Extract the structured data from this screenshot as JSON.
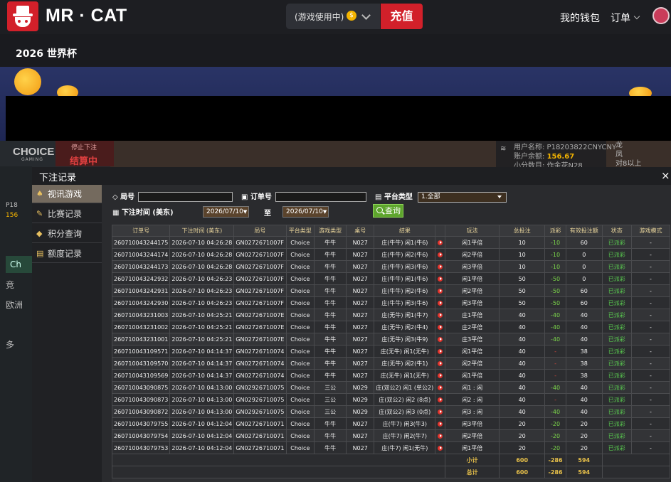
{
  "header": {
    "brand": "MR · CAT",
    "game_status": "(游戏使用中)",
    "recharge_label": "充值",
    "wallet_label": "我的钱包",
    "orders_label": "订单",
    "worldcup_label": "2026 世界杯"
  },
  "background": {
    "choice_logo": "CHOICE",
    "choice_sub": "GAMING",
    "bet_status": "停止下注",
    "bet_result": "结算中",
    "user_line1": "用户名称: P18203822CNYCNY",
    "user_line2_label": "账户余额:",
    "user_balance": "156.67",
    "user_line3": "小分数目: 作金花N28",
    "right_names": [
      "龙",
      "凤",
      "对8以上"
    ],
    "left_items": [
      "竞",
      "欧洲",
      "多"
    ],
    "left_green": "Ch",
    "left_partial": [
      "P18",
      "156"
    ]
  },
  "modal": {
    "title": "下注记录",
    "close": "×",
    "nav": [
      {
        "label": "视讯游戏",
        "icon": "cards-icon",
        "glyph": "♠"
      },
      {
        "label": "比赛记录",
        "icon": "edit-icon",
        "glyph": "✎"
      },
      {
        "label": "积分查询",
        "icon": "diamond-icon",
        "glyph": "◆"
      },
      {
        "label": "额度记录",
        "icon": "doc-icon",
        "glyph": "▤"
      }
    ],
    "filters": {
      "round_label": "局号",
      "order_label": "订单号",
      "platform_label": "平台类型",
      "platform_value": "1.全部",
      "time_label": "下注时间 (美东)",
      "date_from": "2026/07/10",
      "to_label": "至",
      "date_to": "2026/07/10",
      "search_label": "查询"
    },
    "table": {
      "headers": [
        "订单号",
        "下注时间 (美东)",
        "局号",
        "平台类型",
        "游戏类型",
        "桌号",
        "结果",
        "",
        "玩法",
        "总投注",
        "派彩",
        "有效投注额",
        "状态",
        "游戏模式"
      ],
      "rows": [
        [
          "260710043244175",
          "2026-07-10 04:26:28",
          "GN027267100​7F",
          "Choice",
          "牛牛",
          "N027",
          "庄(牛牛) 闲1(牛6)",
          "闲1平倍",
          "10",
          "-10",
          "60",
          "已派彩",
          "-"
        ],
        [
          "260710043244174",
          "2026-07-10 04:26:28",
          "GN027267100​7F",
          "Choice",
          "牛牛",
          "N027",
          "庄(牛牛) 闲2(牛6)",
          "闲2平倍",
          "10",
          "-10",
          "0",
          "已派彩",
          "-"
        ],
        [
          "260710043244173",
          "2026-07-10 04:26:28",
          "GN027267100​7F",
          "Choice",
          "牛牛",
          "N027",
          "庄(牛牛) 闲3(牛6)",
          "闲3平倍",
          "10",
          "-10",
          "0",
          "已派彩",
          "-"
        ],
        [
          "260710043242932",
          "2026-07-10 04:26:23",
          "GN027267100​7F",
          "Choice",
          "牛牛",
          "N027",
          "庄(牛牛) 闲1(牛6)",
          "闲1平倍",
          "50",
          "-50",
          "0",
          "已派彩",
          "-"
        ],
        [
          "260710043242931",
          "2026-07-10 04:26:23",
          "GN027267100​7F",
          "Choice",
          "牛牛",
          "N027",
          "庄(牛牛) 闲2(牛6)",
          "闲2平倍",
          "50",
          "-50",
          "60",
          "已派彩",
          "-"
        ],
        [
          "260710043242930",
          "2026-07-10 04:26:23",
          "GN027267100​7F",
          "Choice",
          "牛牛",
          "N027",
          "庄(牛牛) 闲3(牛6)",
          "闲3平倍",
          "50",
          "-50",
          "60",
          "已派彩",
          "-"
        ],
        [
          "260710043231003",
          "2026-07-10 04:25:21",
          "GN027267100​7E",
          "Choice",
          "牛牛",
          "N027",
          "庄(无牛) 闲1(牛7)",
          "庄1平倍",
          "40",
          "-40",
          "40",
          "已派彩",
          "-"
        ],
        [
          "260710043231002",
          "2026-07-10 04:25:21",
          "GN027267100​7E",
          "Choice",
          "牛牛",
          "N027",
          "庄(无牛) 闲2(牛4)",
          "庄2平倍",
          "40",
          "-40",
          "40",
          "已派彩",
          "-"
        ],
        [
          "260710043231001",
          "2026-07-10 04:25:21",
          "GN027267100​7E",
          "Choice",
          "牛牛",
          "N027",
          "庄(无牛) 闲3(牛9)",
          "庄3平倍",
          "40",
          "-40",
          "40",
          "已派彩",
          "-"
        ],
        [
          "260710043109571",
          "2026-07-10 04:14:37",
          "GN02726710074",
          "Choice",
          "牛牛",
          "N027",
          "庄(无牛) 闲1(无牛)",
          "闲1平倍",
          "40",
          "-",
          "38",
          "已派彩",
          "-"
        ],
        [
          "260710043109570",
          "2026-07-10 04:14:37",
          "GN02726710074",
          "Choice",
          "牛牛",
          "N027",
          "庄(无牛) 闲2(牛1)",
          "闲2平倍",
          "40",
          "-",
          "38",
          "已派彩",
          "-"
        ],
        [
          "260710043109569",
          "2026-07-10 04:14:37",
          "GN02726710074",
          "Choice",
          "牛牛",
          "N027",
          "庄(无牛) 闲1(无牛)",
          "闲1平倍",
          "40",
          "-",
          "38",
          "已派彩",
          "-"
        ],
        [
          "260710043090875",
          "2026-07-10 04:13:00",
          "GN02926710075",
          "Choice",
          "三公",
          "N029",
          "庄(双公2) 闲1 (单公2)",
          "闲1 : 闲",
          "40",
          "-40",
          "40",
          "已派彩",
          "-"
        ],
        [
          "260710043090873",
          "2026-07-10 04:13:00",
          "GN02926710075",
          "Choice",
          "三公",
          "N029",
          "庄(双公2) 闲2 (8点)",
          "闲2 : 闲",
          "40",
          "-",
          "40",
          "已派彩",
          "-"
        ],
        [
          "260710043090872",
          "2026-07-10 04:13:00",
          "GN02926710075",
          "Choice",
          "三公",
          "N029",
          "庄(双公2) 闲3 (0点)",
          "闲3 : 闲",
          "40",
          "-40",
          "40",
          "已派彩",
          "-"
        ],
        [
          "260710043079755",
          "2026-07-10 04:12:04",
          "GN02726710071",
          "Choice",
          "牛牛",
          "N027",
          "庄(牛7) 闲3(牛3)",
          "闲3平倍",
          "20",
          "-20",
          "20",
          "已派彩",
          "-"
        ],
        [
          "260710043079754",
          "2026-07-10 04:12:04",
          "GN02726710071",
          "Choice",
          "牛牛",
          "N027",
          "庄(牛7) 闲2(牛7)",
          "闲2平倍",
          "20",
          "-20",
          "20",
          "已派彩",
          "-"
        ],
        [
          "260710043079753",
          "2026-07-10 04:12:04",
          "GN02726710071",
          "Choice",
          "牛牛",
          "N027",
          "庄(牛7) 闲1(无牛)",
          "闲1平倍",
          "20",
          "-20",
          "20",
          "已派彩",
          "-"
        ]
      ],
      "red_payout_rows": [
        9,
        10,
        11,
        13
      ],
      "subtotal_label": "小计",
      "subtotal": {
        "bet": "600",
        "payout": "-286",
        "valid": "594"
      },
      "total_label": "总计",
      "total": {
        "bet": "600",
        "payout": "-286",
        "valid": "594"
      }
    }
  },
  "colors": {
    "brand_red": "#d2202a",
    "positive_green": "#7bd64a",
    "status_green": "#59c94f",
    "header_gold": "#e8d49b",
    "sum_gold": "#e8c14a"
  }
}
